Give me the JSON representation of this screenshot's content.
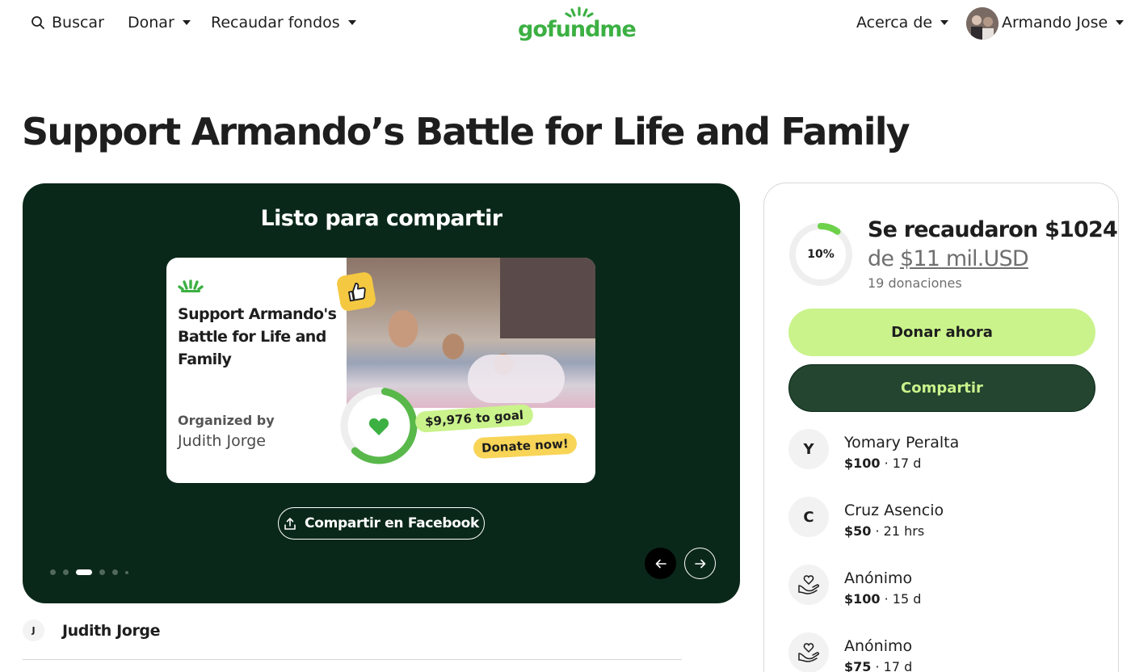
{
  "header": {
    "search_label": "Buscar",
    "donate_label": "Donar",
    "fundraise_label": "Recaudar fondos",
    "logo_text": "gofundme",
    "about_label": "Acerca de",
    "user_name": "Armando Jose"
  },
  "campaign": {
    "title": "Support Armando’s Battle for Life and Family"
  },
  "share_panel": {
    "heading": "Listo para compartir",
    "card_title": "Support Armando's Battle for Life and Family",
    "organized_by_label": "Organized by",
    "organizer_name": "Judith Jorge",
    "goal_pill": "$9,976  to goal",
    "donate_pill": "Donate now!",
    "facebook_button": "Compartir en Facebook",
    "active_slide": 3,
    "slide_count": 6
  },
  "organizer": {
    "initial": "J",
    "name": "Judith Jorge"
  },
  "donation_card": {
    "progress_label": "10%",
    "progress_fraction": 0.1,
    "raised_text": "Se recaudaron $1024",
    "goal_prefix": "de ",
    "goal_amount": "$11 mil.USD",
    "donation_count": "19 donaciones",
    "donate_button": "Donar ahora",
    "share_button": "Compartir",
    "donors": [
      {
        "initial": "Y",
        "name": "Yomary Peralta",
        "amount": "$100",
        "time": " · 17 d"
      },
      {
        "initial": "C",
        "name": "Cruz Asencio",
        "amount": "$50",
        "time": " · 21 hrs"
      },
      {
        "icon": "heart-hand-icon",
        "name": "Anónimo",
        "amount": "$100",
        "time": " · 15 d"
      },
      {
        "icon": "heart-hand-icon",
        "name": "Anónimo",
        "amount": "$75",
        "time": " · 17 d"
      }
    ]
  },
  "colors": {
    "brand_green": "#3cb043",
    "dark_panel": "#0a2819",
    "lime": "#caf38c",
    "share_button": "#24452f"
  }
}
